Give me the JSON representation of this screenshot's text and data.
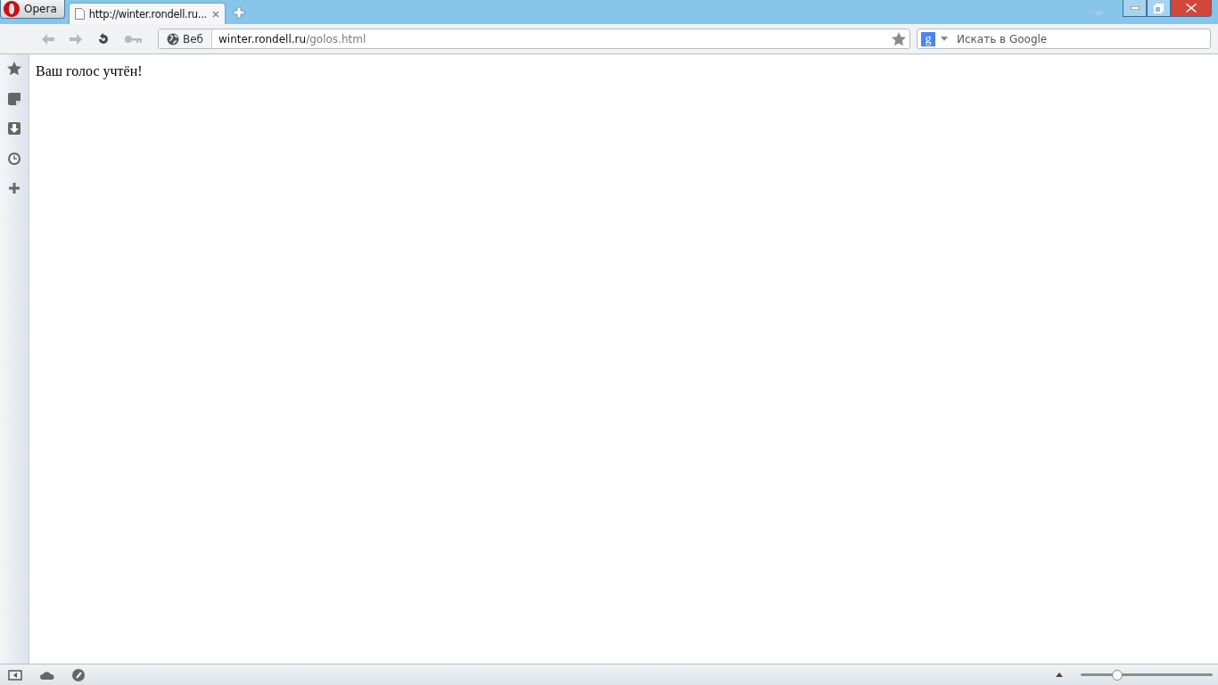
{
  "menu_button": {
    "label": "Opera"
  },
  "tabs": [
    {
      "title": "http://winter.rondell.ru...",
      "selected": true
    }
  ],
  "address_bar": {
    "badge": "Веб",
    "host": "winter.rondell.ru",
    "path": "/golos.html"
  },
  "search": {
    "engine_letter": "g",
    "placeholder": "Искать в Google"
  },
  "page": {
    "text": "Ваш голос учтён!"
  },
  "zoom_slider": {
    "level": 0.28
  }
}
